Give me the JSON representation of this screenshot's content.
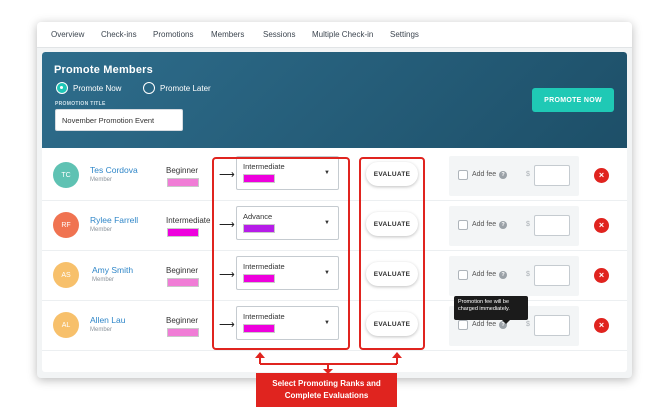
{
  "nav": {
    "items": [
      "Overview",
      "Check-ins",
      "Promotions",
      "Members",
      "Sessions",
      "Multiple Check-in",
      "Settings"
    ]
  },
  "header": {
    "title": "Promote Members",
    "radio_now": "Promote Now",
    "radio_later": "Promote Later",
    "selected": "Promote Now",
    "field_label": "PROMOTION TITLE",
    "title_value": "November Promotion Event",
    "promote_button": "PROMOTE NOW"
  },
  "members": [
    {
      "initials": "TC",
      "name": "Tes Cordova",
      "role": "Member",
      "avatar_color": "#5fc2b3",
      "current_rank": "Beginner",
      "current_rank_color": "#f07cd6",
      "new_rank": "Intermediate",
      "new_rank_color": "#ee00dd"
    },
    {
      "initials": "RF",
      "name": "Rylee Farrell",
      "role": "Member",
      "avatar_color": "#f07351",
      "current_rank": "Intermediate",
      "current_rank_color": "#ee00dd",
      "new_rank": "Advance",
      "new_rank_color": "#b61de8"
    },
    {
      "initials": "AS",
      "name": "Amy Smith",
      "role": "Member",
      "avatar_color": "#f7c06b",
      "current_rank": "Beginner",
      "current_rank_color": "#f07cd6",
      "new_rank": "Intermediate",
      "new_rank_color": "#ee00dd"
    },
    {
      "initials": "AL",
      "name": "Allen Lau",
      "role": "Member",
      "avatar_color": "#f7c06b",
      "current_rank": "Beginner",
      "current_rank_color": "#f07cd6",
      "new_rank": "Intermediate",
      "new_rank_color": "#ee00dd"
    }
  ],
  "row_labels": {
    "evaluate": "EVALUATE",
    "add_fee": "Add fee",
    "currency": "$",
    "remove": "×",
    "help": "?",
    "arrow": "⟶",
    "caret": "▼"
  },
  "tooltip": "Promotion fee will be charged immediately.",
  "callout": {
    "line1": "Select Promoting Ranks and",
    "line2": "Complete Evaluations"
  },
  "colors": {
    "header": "#2a6480",
    "accent": "#1fc9b5",
    "highlight": "#e0241f",
    "link": "#2f86c8"
  }
}
